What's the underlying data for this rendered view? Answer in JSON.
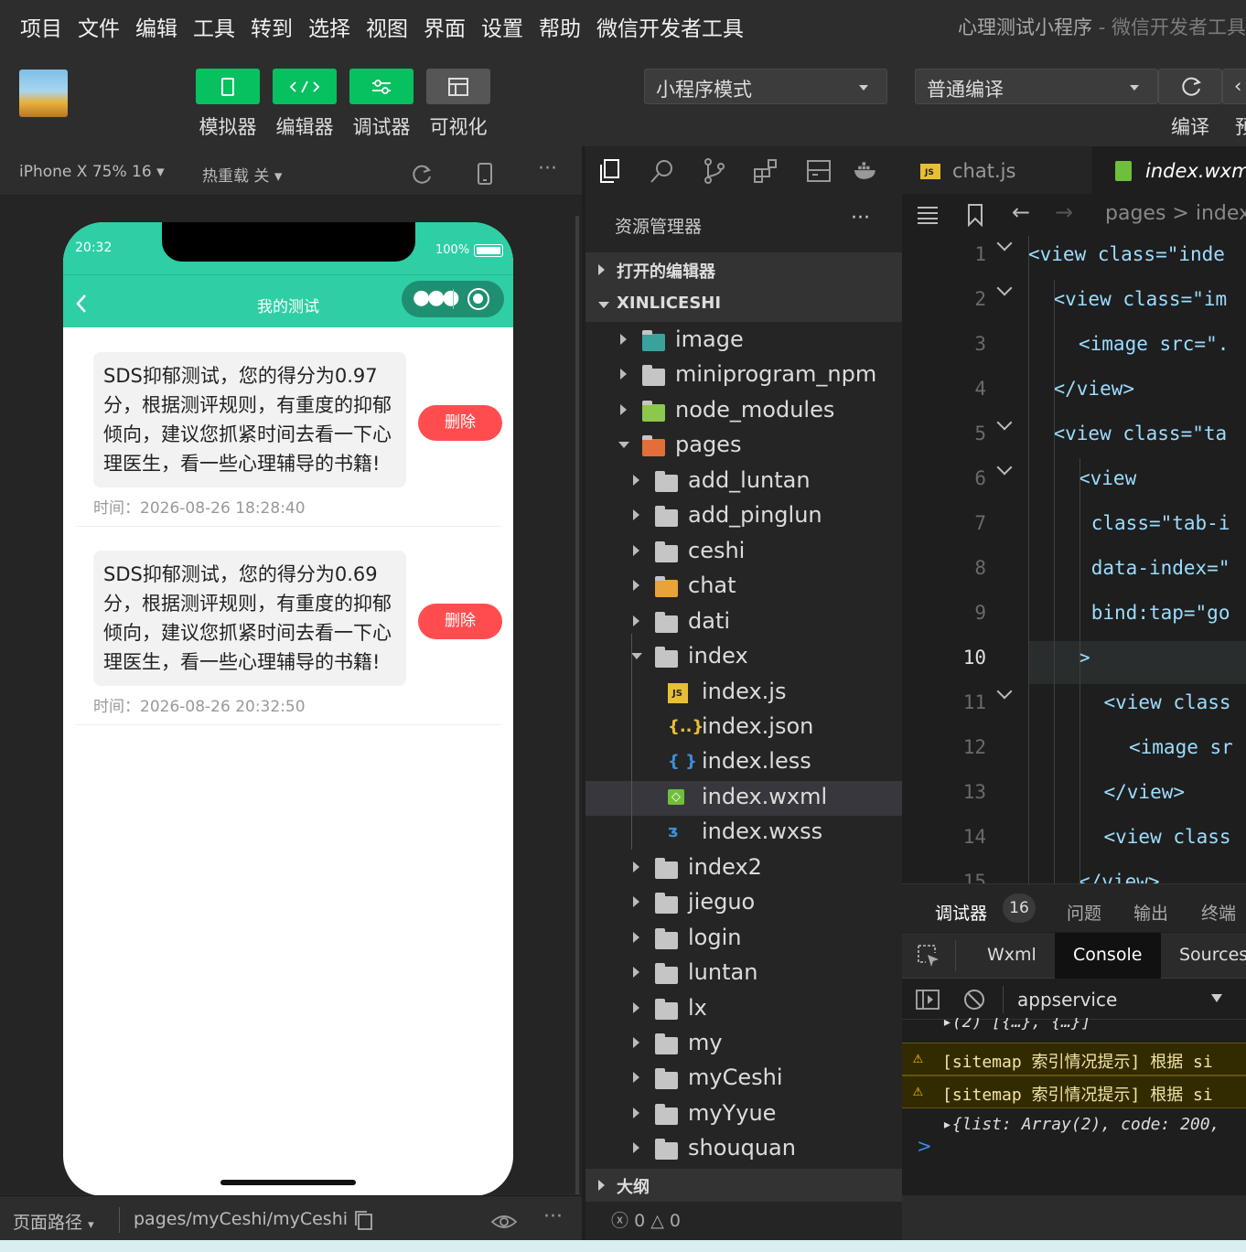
{
  "menubar": {
    "items": [
      "项目",
      "文件",
      "编辑",
      "工具",
      "转到",
      "选择",
      "视图",
      "界面",
      "设置",
      "帮助",
      "微信开发者工具"
    ],
    "title": "心理测试小程序",
    "subtitle": "- 微信开发者工具"
  },
  "toolbar": {
    "buttons": [
      "模拟器",
      "编辑器",
      "调试器",
      "可视化"
    ],
    "mode": "小程序模式",
    "compile_mode": "普通编译",
    "compile_label": "编译",
    "preview_label": "预"
  },
  "simulator": {
    "device": "iPhone X 75% 16",
    "hotreload": "热重载 关",
    "phone": {
      "time": "20:32",
      "battery": "100%",
      "page_title": "我的测试",
      "records": [
        {
          "text": "SDS抑郁测试，您的得分为0.97分，根据测评规则，有重度的抑郁倾向，建议您抓紧时间去看一下心理医生，看一些心理辅导的书籍!",
          "time": "时间：2026-08-26 18:28:40",
          "action": "删除"
        },
        {
          "text": "SDS抑郁测试，您的得分为0.69分，根据测评规则，有重度的抑郁倾向，建议您抓紧时间去看一下心理医生，看一些心理辅导的书籍!",
          "time": "时间：2026-08-26 20:32:50",
          "action": "删除"
        }
      ]
    },
    "footer": {
      "path_label": "页面路径",
      "path": "pages/myCeshi/myCeshi"
    }
  },
  "explorer": {
    "title": "资源管理器",
    "open_editors": "打开的编辑器",
    "project": "XINLICESHI",
    "tree": [
      {
        "name": "image",
        "depth": 0,
        "state": "closed",
        "kind": "image-folder"
      },
      {
        "name": "miniprogram_npm",
        "depth": 0,
        "state": "closed",
        "kind": "folder"
      },
      {
        "name": "node_modules",
        "depth": 0,
        "state": "closed",
        "kind": "node-folder"
      },
      {
        "name": "pages",
        "depth": 0,
        "state": "open",
        "kind": "pages-folder"
      },
      {
        "name": "add_luntan",
        "depth": 1,
        "state": "closed",
        "kind": "folder"
      },
      {
        "name": "add_pinglun",
        "depth": 1,
        "state": "closed",
        "kind": "folder"
      },
      {
        "name": "ceshi",
        "depth": 1,
        "state": "closed",
        "kind": "folder"
      },
      {
        "name": "chat",
        "depth": 1,
        "state": "closed",
        "kind": "chat-folder"
      },
      {
        "name": "dati",
        "depth": 1,
        "state": "closed",
        "kind": "folder"
      },
      {
        "name": "index",
        "depth": 1,
        "state": "open",
        "kind": "folder-open"
      },
      {
        "name": "index.js",
        "depth": 2,
        "state": "file",
        "kind": "js"
      },
      {
        "name": "index.json",
        "depth": 2,
        "state": "file",
        "kind": "json"
      },
      {
        "name": "index.less",
        "depth": 2,
        "state": "file",
        "kind": "less"
      },
      {
        "name": "index.wxml",
        "depth": 2,
        "state": "file",
        "kind": "wxml",
        "selected": true
      },
      {
        "name": "index.wxss",
        "depth": 2,
        "state": "file",
        "kind": "wxss"
      },
      {
        "name": "index2",
        "depth": 1,
        "state": "closed",
        "kind": "folder"
      },
      {
        "name": "jieguo",
        "depth": 1,
        "state": "closed",
        "kind": "folder"
      },
      {
        "name": "login",
        "depth": 1,
        "state": "closed",
        "kind": "folder"
      },
      {
        "name": "luntan",
        "depth": 1,
        "state": "closed",
        "kind": "folder"
      },
      {
        "name": "lx",
        "depth": 1,
        "state": "closed",
        "kind": "folder"
      },
      {
        "name": "my",
        "depth": 1,
        "state": "closed",
        "kind": "folder"
      },
      {
        "name": "myCeshi",
        "depth": 1,
        "state": "closed",
        "kind": "folder"
      },
      {
        "name": "myYyue",
        "depth": 1,
        "state": "closed",
        "kind": "folder"
      },
      {
        "name": "shouquan",
        "depth": 1,
        "state": "closed",
        "kind": "folder"
      }
    ],
    "outline": "大纲",
    "errors": "0",
    "warnings": "0"
  },
  "editor": {
    "tabs": [
      "chat.js",
      "index.wxml"
    ],
    "breadcrumb": "pages > index",
    "lines": [
      {
        "n": "1",
        "code": "<view class=\"inde",
        "indent": 0,
        "fold": true
      },
      {
        "n": "2",
        "code": "<view class=\"im",
        "indent": 1,
        "fold": true
      },
      {
        "n": "3",
        "code": "<image src=\".",
        "indent": 2,
        "fold": false
      },
      {
        "n": "4",
        "code": "</view>",
        "indent": 1,
        "fold": false
      },
      {
        "n": "5",
        "code": "<view class=\"ta",
        "indent": 1,
        "fold": true
      },
      {
        "n": "6",
        "code": "<view",
        "indent": 2,
        "fold": true
      },
      {
        "n": "7",
        "code": "class=\"tab-i",
        "indent": 2.5,
        "fold": false
      },
      {
        "n": "8",
        "code": "data-index=\"",
        "indent": 2.5,
        "fold": false
      },
      {
        "n": "9",
        "code": "bind:tap=\"go",
        "indent": 2.5,
        "fold": false
      },
      {
        "n": "10",
        "code": ">",
        "indent": 2,
        "fold": false,
        "current": true
      },
      {
        "n": "11",
        "code": "<view class",
        "indent": 3,
        "fold": true
      },
      {
        "n": "12",
        "code": "<image sr",
        "indent": 4,
        "fold": false
      },
      {
        "n": "13",
        "code": "</view>",
        "indent": 3,
        "fold": false
      },
      {
        "n": "14",
        "code": "<view class",
        "indent": 3,
        "fold": false
      },
      {
        "n": "15",
        "code": "</view>",
        "indent": 2,
        "fold": false
      }
    ]
  },
  "devtools": {
    "tabs": [
      "调试器",
      "问题",
      "输出",
      "终端"
    ],
    "badge": "16",
    "subtabs": [
      "Wxml",
      "Console",
      "Sources"
    ],
    "context": "appservice",
    "console": [
      {
        "type": "log",
        "text": "▸(2) [{…}, {…}]"
      },
      {
        "type": "warn",
        "text": "[sitemap 索引情况提示] 根据 si"
      },
      {
        "type": "warn",
        "text": "[sitemap 索引情况提示] 根据 si"
      },
      {
        "type": "log",
        "text": "▸{list: Array(2), code: 200,"
      }
    ],
    "prompt": ">"
  }
}
